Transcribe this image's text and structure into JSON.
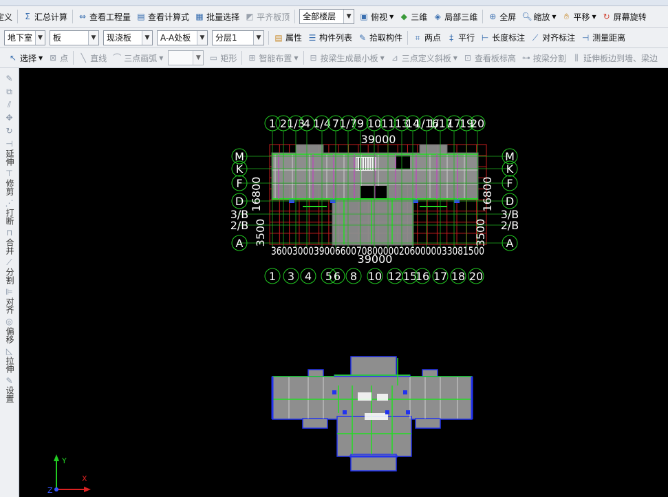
{
  "toolbar1": {
    "items": [
      {
        "label": "定义",
        "icon": "define-icon"
      },
      {
        "label": "汇总计算",
        "icon": "sum-icon"
      },
      {
        "label": "查看工程量",
        "icon": "quantity-icon"
      },
      {
        "label": "查看计算式",
        "icon": "formula-icon"
      },
      {
        "label": "批量选择",
        "icon": "batch-select-icon"
      },
      {
        "label": "平齐板顶",
        "icon": "align-top-icon",
        "disabled": true
      }
    ],
    "floor_select": "全部楼层",
    "view_items": [
      {
        "label": "俯视",
        "icon": "top-view-icon"
      },
      {
        "label": "三维",
        "icon": "3d-icon"
      },
      {
        "label": "局部三维",
        "icon": "local-3d-icon"
      },
      {
        "label": "全屏",
        "icon": "fullscreen-icon"
      },
      {
        "label": "缩放",
        "icon": "zoom-icon"
      },
      {
        "label": "平移",
        "icon": "pan-icon"
      },
      {
        "label": "屏幕旋转",
        "icon": "rotate-icon"
      }
    ]
  },
  "toolbar2": {
    "selects": [
      "地下室",
      "板",
      "现浇板",
      "A-A处板",
      "分层1"
    ],
    "items": [
      {
        "label": "属性",
        "icon": "properties-icon"
      },
      {
        "label": "构件列表",
        "icon": "component-list-icon"
      },
      {
        "label": "拾取构件",
        "icon": "pick-icon"
      },
      {
        "label": "两点",
        "icon": "two-point-icon"
      },
      {
        "label": "平行",
        "icon": "parallel-icon"
      },
      {
        "label": "长度标注",
        "icon": "length-dim-icon"
      },
      {
        "label": "对齐标注",
        "icon": "align-dim-icon"
      },
      {
        "label": "测量距离",
        "icon": "measure-icon"
      }
    ]
  },
  "toolbar3": {
    "items": [
      {
        "label": "选择",
        "icon": "select-icon"
      },
      {
        "label": "点",
        "icon": "point-icon"
      },
      {
        "label": "直线",
        "icon": "line-icon"
      },
      {
        "label": "三点画弧",
        "icon": "arc-icon"
      },
      {
        "label": "矩形",
        "icon": "rect-icon"
      },
      {
        "label": "智能布置",
        "icon": "smart-layout-icon"
      },
      {
        "label": "按梁生成最小板",
        "icon": "beam-slab-icon"
      },
      {
        "label": "三点定义斜板",
        "icon": "slope-slab-icon"
      },
      {
        "label": "查看板标高",
        "icon": "slab-elevation-icon"
      },
      {
        "label": "按梁分割",
        "icon": "split-beam-icon"
      },
      {
        "label": "延伸板边到墙、梁边",
        "icon": "extend-slab-icon"
      }
    ]
  },
  "sidebar": {
    "items": [
      {
        "label": "",
        "icon": "pen-icon"
      },
      {
        "label": "",
        "icon": "copy-icon"
      },
      {
        "label": "",
        "icon": "mirror-icon"
      },
      {
        "label": "",
        "icon": "move-icon"
      },
      {
        "label": "",
        "icon": "rotate-icon"
      },
      {
        "label": "延伸",
        "icon": "extend-icon"
      },
      {
        "label": "修剪",
        "icon": "trim-icon"
      },
      {
        "label": "打断",
        "icon": "break-icon"
      },
      {
        "label": "合并",
        "icon": "merge-icon"
      },
      {
        "label": "分割",
        "icon": "split-icon"
      },
      {
        "label": "对齐",
        "icon": "align-icon"
      },
      {
        "label": "偏移",
        "icon": "offset-icon"
      },
      {
        "label": "拉伸",
        "icon": "stretch-icon"
      },
      {
        "label": "设置",
        "icon": "settings-icon"
      }
    ]
  },
  "drawing": {
    "top_axes": [
      "1",
      "2",
      "1/3",
      "4",
      "1/4",
      "7",
      "1/7",
      "9",
      "10",
      "11",
      "13",
      "14",
      "1/16",
      "1/17",
      "17",
      "19",
      "20"
    ],
    "top_dimension": "39000",
    "left_axes": [
      "M",
      "K",
      "F",
      "D",
      "3/B",
      "2/B",
      "A"
    ],
    "right_axes": [
      "M",
      "K",
      "F",
      "D",
      "3/B",
      "2/B",
      "A"
    ],
    "left_dimension": "16800",
    "left_dim_2": "3500",
    "bottom_axes": [
      "1",
      "3",
      "4",
      "5",
      "6",
      "8",
      "10",
      "12",
      "15",
      "16",
      "17",
      "18",
      "20"
    ],
    "bottom_dimension": "39000",
    "bottom_segments": "3600300039006600708000002060000033081500"
  },
  "axis_indicator": {
    "x": "X",
    "y": "Y",
    "z": "Z"
  }
}
